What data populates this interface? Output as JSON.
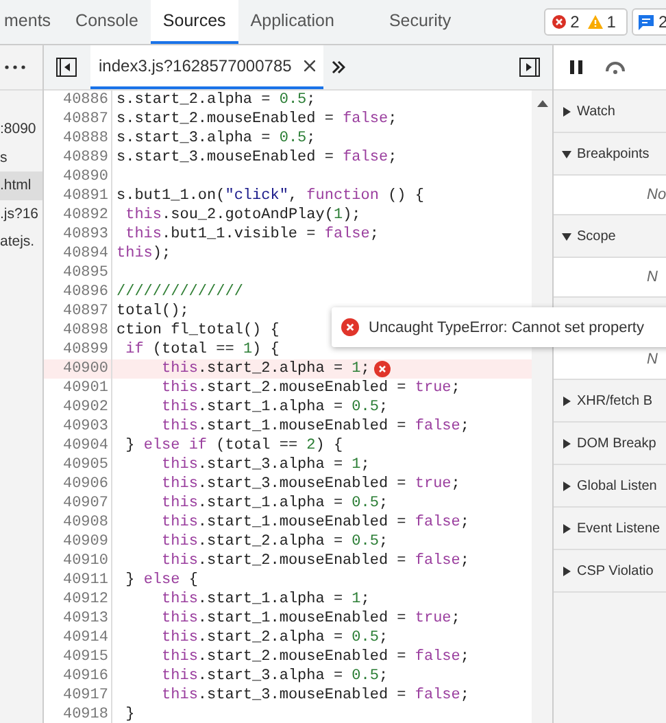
{
  "tabs": [
    {
      "label": "ments",
      "selected": false
    },
    {
      "label": "Console",
      "selected": false
    },
    {
      "label": "Sources",
      "selected": true
    },
    {
      "label": "Application",
      "selected": false
    },
    {
      "label": "Security",
      "selected": false
    }
  ],
  "issues": [
    {
      "kind": "error",
      "count": "2"
    },
    {
      "kind": "warning",
      "count": "1"
    },
    {
      "kind": "message",
      "count": "2"
    }
  ],
  "file_tree": [
    {
      "label": ":8090",
      "selected": false
    },
    {
      "label": "s",
      "selected": false
    },
    {
      "label": ".html",
      "selected": true
    },
    {
      "label": ".js?16",
      "selected": false
    },
    {
      "label": "atejs.",
      "selected": false
    }
  ],
  "editor_tabs": [
    {
      "label": "index3.js?1628577000785",
      "selected": true
    }
  ],
  "code": {
    "lines": [
      {
        "number": "40886",
        "text": "s.start_2.alpha = 0.5;",
        "error": false
      },
      {
        "number": "40887",
        "text": "s.start_2.mouseEnabled = false;",
        "error": false
      },
      {
        "number": "40888",
        "text": "s.start_3.alpha = 0.5;",
        "error": false
      },
      {
        "number": "40889",
        "text": "s.start_3.mouseEnabled = false;",
        "error": false
      },
      {
        "number": "40890",
        "error": false
      },
      {
        "number": "40891",
        "text": "s.but1_1.on(\"click\", function () {",
        "error": false
      },
      {
        "number": "40892",
        "text": " this.sou_2.gotoAndPlay(1);",
        "error": false
      },
      {
        "number": "40893",
        "text": " this.but1_1.visible = false;",
        "error": false
      },
      {
        "number": "40894",
        "text": "this);",
        "error": false
      },
      {
        "number": "40895",
        "error": false
      },
      {
        "number": "40896",
        "text": "//////////////",
        "error": false
      },
      {
        "number": "40897",
        "text": "total();",
        "error": false
      },
      {
        "number": "40898",
        "text": "ction fl_total() {",
        "error": false
      },
      {
        "number": "40899",
        "text": " if (total == 1) {",
        "error": false
      },
      {
        "number": "40900",
        "text": "     this.start_2.alpha = 1;",
        "error": true
      },
      {
        "number": "40901",
        "text": "     this.start_2.mouseEnabled = true;",
        "error": false
      },
      {
        "number": "40902",
        "text": "     this.start_1.alpha = 0.5;",
        "error": false
      },
      {
        "number": "40903",
        "text": "     this.start_1.mouseEnabled = false;",
        "error": false
      },
      {
        "number": "40904",
        "text": " } else if (total == 2) {",
        "error": false
      },
      {
        "number": "40905",
        "text": "     this.start_3.alpha = 1;",
        "error": false
      },
      {
        "number": "40906",
        "text": "     this.start_3.mouseEnabled = true;",
        "error": false
      },
      {
        "number": "40907",
        "text": "     this.start_1.alpha = 0.5;",
        "error": false
      },
      {
        "number": "40908",
        "text": "     this.start_1.mouseEnabled = false;",
        "error": false
      },
      {
        "number": "40909",
        "text": "     this.start_2.alpha = 0.5;",
        "error": false
      },
      {
        "number": "40910",
        "text": "     this.start_2.mouseEnabled = false;",
        "error": false
      },
      {
        "number": "40911",
        "text": " } else {",
        "error": false
      },
      {
        "number": "40912",
        "text": "     this.start_1.alpha = 1;",
        "error": false
      },
      {
        "number": "40913",
        "text": "     this.start_1.mouseEnabled = true;",
        "error": false
      },
      {
        "number": "40914",
        "text": "     this.start_2.alpha = 0.5;",
        "error": false
      },
      {
        "number": "40915",
        "text": "     this.start_2.mouseEnabled = false;",
        "error": false
      },
      {
        "number": "40916",
        "text": "     this.start_3.alpha = 0.5;",
        "error": false
      },
      {
        "number": "40917",
        "text": "     this.start_3.mouseEnabled = false;",
        "error": false
      },
      {
        "number": "40918",
        "text": " }",
        "error": false
      }
    ]
  },
  "error_tooltip": {
    "message": "Uncaught TypeError: Cannot set property"
  },
  "debugger": {
    "sections": [
      {
        "title": "Watch",
        "expanded": false
      },
      {
        "title": "Breakpoints",
        "expanded": true,
        "content": "No"
      },
      {
        "title": "Scope",
        "expanded": true,
        "content": "N"
      },
      {
        "content": "N"
      },
      {
        "title": "XHR/fetch B",
        "expanded": false
      },
      {
        "title": "DOM Breakp",
        "expanded": false
      },
      {
        "title": "Global Listen",
        "expanded": false
      },
      {
        "title": "Event Listene",
        "expanded": false
      },
      {
        "title": "CSP Violatio",
        "expanded": false
      }
    ]
  }
}
